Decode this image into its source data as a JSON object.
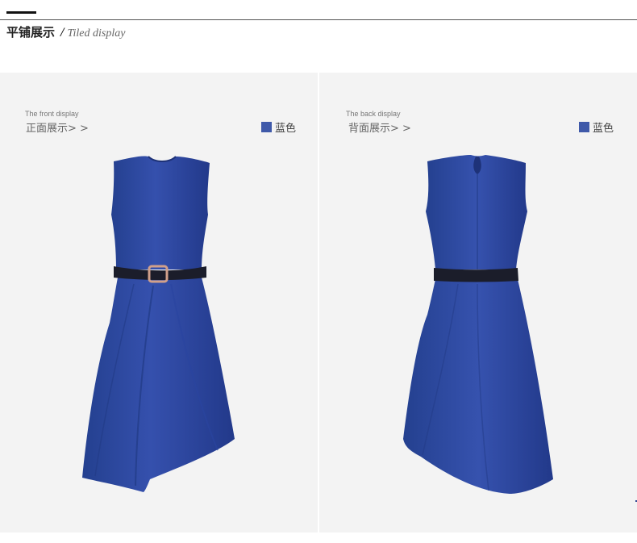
{
  "header": {
    "title_cn": "平铺展示",
    "slash": "/",
    "title_en": "Tiled display"
  },
  "front_panel": {
    "label_en": "The front display",
    "label_cn": "正面展示> >",
    "color_name": "蓝色",
    "image_alt": "front view of sleeveless blue dress with black belt"
  },
  "back_panel": {
    "label_en": "The back display",
    "label_cn": "背面展示> >",
    "color_name": "蓝色",
    "image_alt": "back view of sleeveless blue dress with black belt"
  },
  "colors": {
    "swatch": "#3f59a9",
    "dress": "#2e47a3",
    "belt": "#1b1d2a",
    "panel_bg": "#f3f3f3"
  }
}
